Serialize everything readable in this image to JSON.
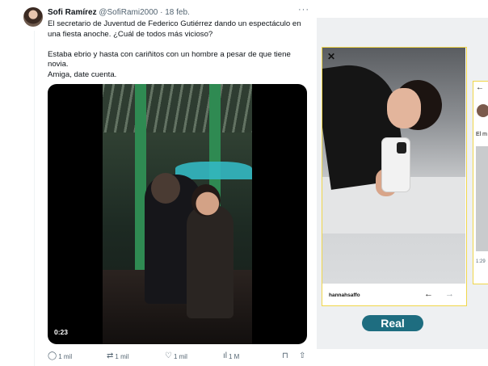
{
  "tweet": {
    "author_name": "Sofi Ramírez",
    "handle": "@SofiRami2000",
    "separator": "·",
    "date": "18 feb.",
    "more_label": "···",
    "text_paragraph_1": "El secretario de Juventud de Federico Gutiérrez dando un espectáculo en una fiesta anoche. ¿Cuál de todos más vicioso?",
    "text_paragraph_2_line_1": "Estaba ebrio y hasta con cariñitos con un hombre a pesar de que tiene novia.",
    "text_paragraph_2_line_2": "Amiga, date cuenta.",
    "video_duration": "0:23",
    "actions": {
      "replies": "1 mil",
      "retweets": "1 mil",
      "likes": "1 mil",
      "views": "1 M"
    }
  },
  "panel": {
    "close_label": "✕",
    "caption": "hannahsaffo",
    "prev_arrow": "←",
    "next_arrow": "→",
    "badge_label": "Real",
    "card2_back": "←",
    "card2_text": "El m",
    "card2_time": "1:29"
  },
  "icons": {
    "reply": "comment-icon",
    "retweet": "retweet-icon",
    "like": "heart-icon",
    "views": "bar-chart-icon",
    "bookmark": "bookmark-icon",
    "share": "share-icon"
  },
  "colors": {
    "badge": "#1e6d80",
    "card_border": "#f0d64a",
    "secondary_text": "#536471"
  }
}
